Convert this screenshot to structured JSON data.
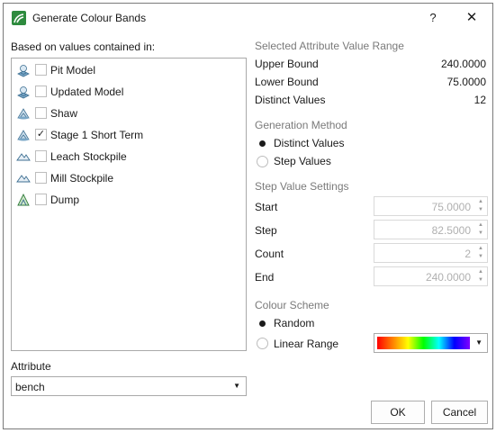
{
  "window": {
    "title": "Generate Colour Bands",
    "help": "?",
    "close": "✕"
  },
  "left": {
    "based_on_label": "Based on values contained in:",
    "items": [
      {
        "label": "Pit Model",
        "checked": false,
        "icon": "block-model-icon"
      },
      {
        "label": "Updated Model",
        "checked": false,
        "icon": "block-model-icon"
      },
      {
        "label": "Shaw",
        "checked": false,
        "icon": "block-model-icon"
      },
      {
        "label": "Stage 1 Short Term",
        "checked": true,
        "check": "✓",
        "icon": "block-model-icon"
      },
      {
        "label": "Leach Stockpile",
        "checked": false,
        "icon": "surface-icon"
      },
      {
        "label": "Mill Stockpile",
        "checked": false,
        "icon": "surface-icon"
      },
      {
        "label": "Dump",
        "checked": false,
        "icon": "surface-green-icon"
      }
    ],
    "attribute_label": "Attribute",
    "attribute_value": "bench"
  },
  "right": {
    "range_title": "Selected Attribute Value Range",
    "upper_label": "Upper Bound",
    "upper_value": "240.0000",
    "lower_label": "Lower Bound",
    "lower_value": "75.0000",
    "distinct_label": "Distinct Values",
    "distinct_value": "12",
    "method_title": "Generation Method",
    "method_options": [
      {
        "label": "Distinct Values",
        "selected": true
      },
      {
        "label": "Step Values",
        "selected": false
      }
    ],
    "step_title": "Step Value Settings",
    "step_rows": [
      {
        "label": "Start",
        "value": "75.0000"
      },
      {
        "label": "Step",
        "value": "82.5000"
      },
      {
        "label": "Count",
        "value": "2"
      },
      {
        "label": "End",
        "value": "240.0000"
      }
    ],
    "scheme_title": "Colour Scheme",
    "scheme_options": [
      {
        "label": "Random",
        "selected": true
      },
      {
        "label": "Linear Range",
        "selected": false
      }
    ]
  },
  "buttons": {
    "ok": "OK",
    "cancel": "Cancel"
  },
  "colors": {
    "app_icon": "#2e8b3e",
    "section_title": "#7a7a7a",
    "disabled_text": "#b0b0b0"
  }
}
